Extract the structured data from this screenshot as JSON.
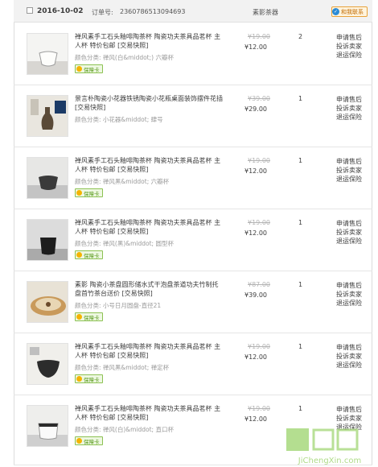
{
  "header": {
    "date": "2016-10-02",
    "order_label": "订单号:",
    "order_number": "2360786513094693",
    "shop": "素影茶器",
    "badge": "和我联系"
  },
  "items": [
    {
      "title": "禅风素手工石头釉啡陶茶杯 陶瓷功夫茶具品茗杯 主人杯 特价包邮 [交易快照]",
      "spec": "颜色分类: 禅风(白&middot;) 六瓣杯",
      "badge": "保障卡",
      "orig": "¥19.00",
      "price": "¥12.00",
      "qty": "2",
      "actions": [
        "申请售后",
        "投诉卖家",
        "退运保险"
      ],
      "img": "white-cup"
    },
    {
      "title": "景言朴陶瓷小花器铁锈陶瓷小花瓶桌面装饰摆件花插 [交易快照]",
      "spec": "颜色分类: 小花器&middot; 肆号",
      "badge": "",
      "orig": "¥39.00",
      "price": "¥29.00",
      "qty": "1",
      "actions": [
        "申请售后",
        "投诉卖家",
        "退运保险"
      ],
      "img": "vase"
    },
    {
      "title": "禅风素手工石头釉啡陶茶杯 陶瓷功夫茶具品茗杯 主人杯 特价包邮 [交易快照]",
      "spec": "颜色分类: 禅风黑&middot; 六瓣杯",
      "badge": "保障卡",
      "orig": "¥19.00",
      "price": "¥12.00",
      "qty": "1",
      "actions": [
        "申请售后",
        "投诉卖家",
        "退运保险"
      ],
      "img": "dark-cup"
    },
    {
      "title": "禅风素手工石头釉啡陶茶杯 陶瓷功夫茶具品茗杯 主人杯 特价包邮 [交易快照]",
      "spec": "颜色分类: 禅风(黑)&middot; 圆型杯",
      "badge": "保障卡",
      "orig": "¥19.00",
      "price": "¥12.00",
      "qty": "1",
      "actions": [
        "申请售后",
        "投诉卖家",
        "退运保险"
      ],
      "img": "black-cup"
    },
    {
      "title": "素影 陶瓷小茶盘圆形储水式干泡盘茶道功夫竹制托盘首竹茶台送价 [交易快照]",
      "spec": "颜色分类: 小号日月圆盘-直径21",
      "badge": "保障卡",
      "orig": "¥87.00",
      "price": "¥39.00",
      "qty": "1",
      "actions": [
        "申请售后",
        "投诉卖家",
        "退运保险"
      ],
      "img": "tray"
    },
    {
      "title": "禅风素手工石头釉啡陶茶杯 陶瓷功夫茶具品茗杯 主人杯 特价包邮 [交易快照]",
      "spec": "颜色分类: 禅风黑&middot; 禅定杯",
      "badge": "保障卡",
      "orig": "¥19.00",
      "price": "¥12.00",
      "qty": "1",
      "actions": [
        "申请售后",
        "投诉卖家",
        "退运保险"
      ],
      "img": "dark-bowl"
    },
    {
      "title": "禅风素手工石头釉啡陶茶杯 陶瓷功夫茶具品茗杯 主人杯 特价包邮 [交易快照]",
      "spec": "颜色分类: 禅风(白)&middot; 直口杯",
      "badge": "保障卡",
      "orig": "¥19.00",
      "price": "¥12.00",
      "qty": "1",
      "actions": [
        "申请售后",
        "投诉卖家",
        "退运保险"
      ],
      "img": "white-straight"
    }
  ],
  "watermark": {
    "brand": "集诚信",
    "url": "JiChengXin.com"
  }
}
